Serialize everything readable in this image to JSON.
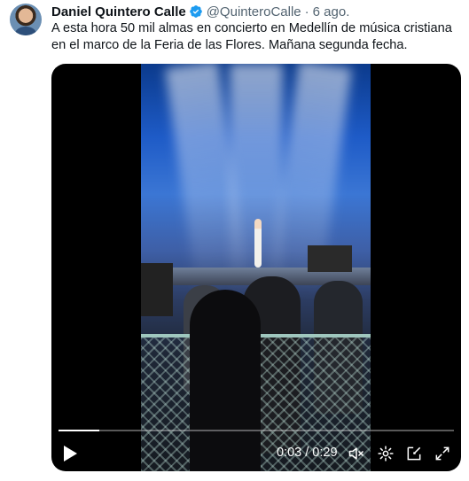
{
  "tweet": {
    "author_name": "Daniel Quintero Calle",
    "handle": "@QuinteroCalle",
    "separator": "·",
    "date": "6 ago.",
    "text": "A esta hora 50 mil almas en concierto en Medellín de música cristiana en el marco de la Feria de las Flores. Mañana segunda fecha.",
    "verified_color": "#1d9bf0"
  },
  "video": {
    "current_time": "0:03",
    "duration": "0:29",
    "time_display": "0:03 / 0:29",
    "progress_fraction": 0.103,
    "controls": {
      "play": "play-icon",
      "volume": "volume-muted-icon",
      "settings": "gear-icon",
      "docking": "dock-icon",
      "fullscreen": "fullscreen-icon"
    }
  },
  "colors": {
    "text_primary": "#0f1419",
    "text_secondary": "#536471",
    "media_background": "#000000"
  }
}
